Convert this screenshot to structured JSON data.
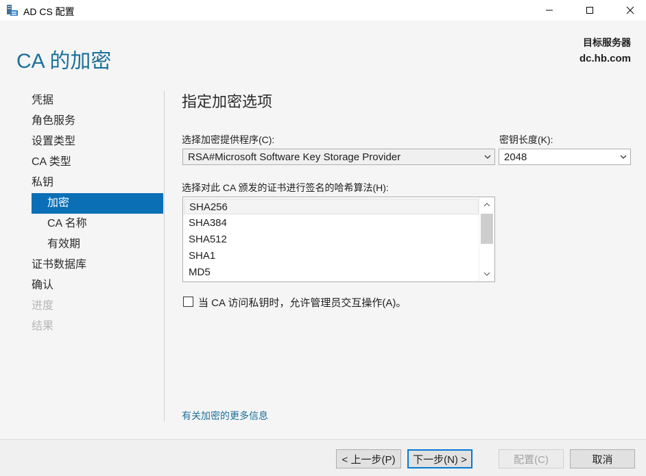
{
  "window": {
    "title": "AD CS 配置",
    "app_icon": "server-manager-icon",
    "controls": {
      "minimize": "minimize-icon",
      "maximize": "maximize-icon",
      "close": "close-icon"
    }
  },
  "header": {
    "title": "CA 的加密",
    "server_label": "目标服务器",
    "server_name": "dc.hb.com"
  },
  "nav": {
    "items": [
      {
        "label": "凭据",
        "state": "normal"
      },
      {
        "label": "角色服务",
        "state": "normal"
      },
      {
        "label": "设置类型",
        "state": "normal"
      },
      {
        "label": "CA 类型",
        "state": "normal"
      },
      {
        "label": "私钥",
        "state": "normal"
      },
      {
        "label": "加密",
        "state": "selected"
      },
      {
        "label": "CA 名称",
        "state": "normal"
      },
      {
        "label": "有效期",
        "state": "normal"
      },
      {
        "label": "证书数据库",
        "state": "normal"
      },
      {
        "label": "确认",
        "state": "normal"
      },
      {
        "label": "进度",
        "state": "disabled"
      },
      {
        "label": "结果",
        "state": "disabled"
      }
    ]
  },
  "main": {
    "section_title": "指定加密选项",
    "provider_label": "选择加密提供程序(C):",
    "provider_value": "RSA#Microsoft Software Key Storage Provider",
    "key_length_label": "密钥长度(K):",
    "key_length_value": "2048",
    "hash_label": "选择对此 CA 颁发的证书进行签名的哈希算法(H):",
    "hash_options": [
      "SHA256",
      "SHA384",
      "SHA512",
      "SHA1",
      "MD5"
    ],
    "hash_selected": "SHA256",
    "allow_interaction_label": "当 CA 访问私钥时，允许管理员交互操作(A)。",
    "allow_interaction_checked": false,
    "more_info_link": "有关加密的更多信息"
  },
  "footer": {
    "prev": "< 上一步(P)",
    "next": "下一步(N) >",
    "configure": "配置(C)",
    "cancel": "取消"
  },
  "colors": {
    "accent": "#0a6fb5",
    "title_blue": "#1a6f9a",
    "panel_bg": "#f5f5f5"
  }
}
